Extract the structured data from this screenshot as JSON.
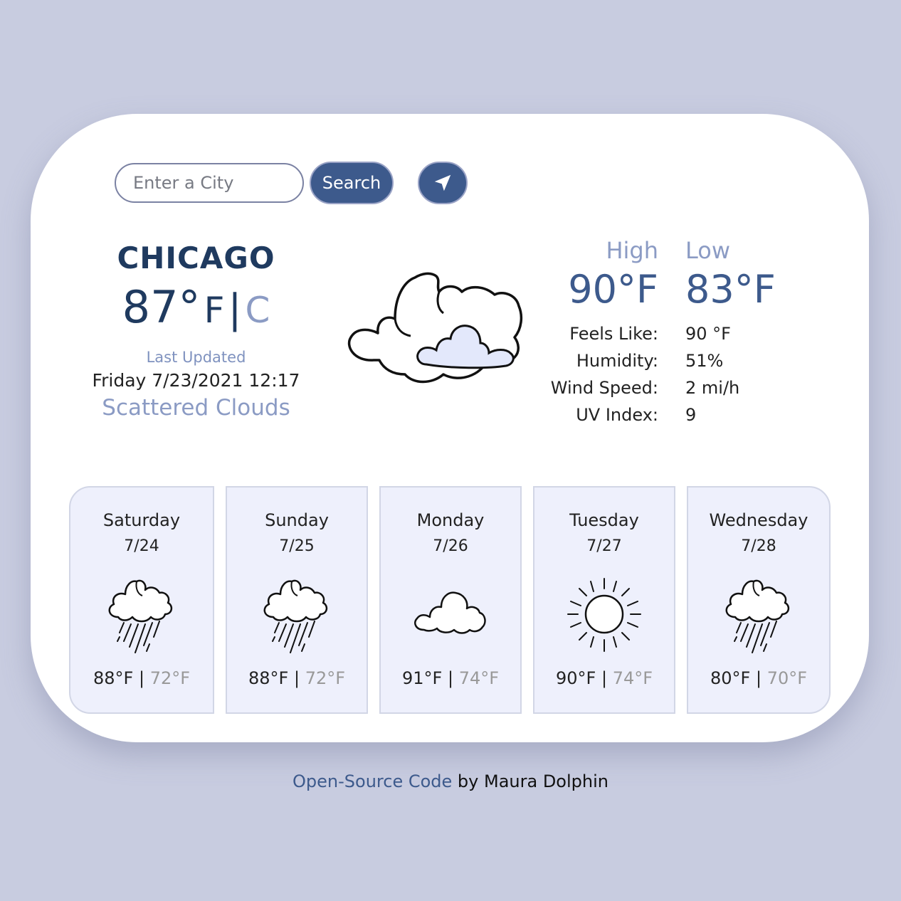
{
  "search": {
    "placeholder": "Enter a City",
    "button_label": "Search",
    "location_button_icon": "location-arrow-icon"
  },
  "current": {
    "city": "CHICAGO",
    "temperature": "87°",
    "unit_f": "F",
    "separator": "|",
    "unit_c": "C",
    "last_updated_label": "Last Updated",
    "last_updated_time": "Friday 7/23/2021 12:17",
    "description": "Scattered Clouds",
    "icon": "scattered-clouds-icon"
  },
  "high_low": {
    "high_label": "High",
    "low_label": "Low",
    "high_value": "90°F",
    "low_value": "83°F"
  },
  "details": [
    {
      "label": "Feels Like:",
      "value": "90 °F"
    },
    {
      "label": "Humidity:",
      "value": "51%"
    },
    {
      "label": "Wind Speed:",
      "value": "2 mi/h"
    },
    {
      "label": "UV Index:",
      "value": "9"
    }
  ],
  "forecast": [
    {
      "day": "Saturday",
      "date": "7/24",
      "icon": "rain-cloud-icon",
      "high": "88°F",
      "low": "72°F"
    },
    {
      "day": "Sunday",
      "date": "7/25",
      "icon": "rain-cloud-icon",
      "high": "88°F",
      "low": "72°F"
    },
    {
      "day": "Monday",
      "date": "7/26",
      "icon": "cloud-icon",
      "high": "91°F",
      "low": "74°F"
    },
    {
      "day": "Tuesday",
      "date": "7/27",
      "icon": "sun-icon",
      "high": "90°F",
      "low": "74°F"
    },
    {
      "day": "Wednesday",
      "date": "7/28",
      "icon": "rain-cloud-icon",
      "high": "80°F",
      "low": "70°F"
    }
  ],
  "forecast_separator": "|",
  "footer": {
    "link_text": "Open-Source Code",
    "by_text": " by ",
    "author": "Maura Dolphin"
  },
  "colors": {
    "background": "#c8cce0",
    "card": "#ffffff",
    "accent": "#3d5a8c",
    "title": "#1f3a5f",
    "muted": "#8b9bc4",
    "forecast_bg": "#eef0fc"
  }
}
